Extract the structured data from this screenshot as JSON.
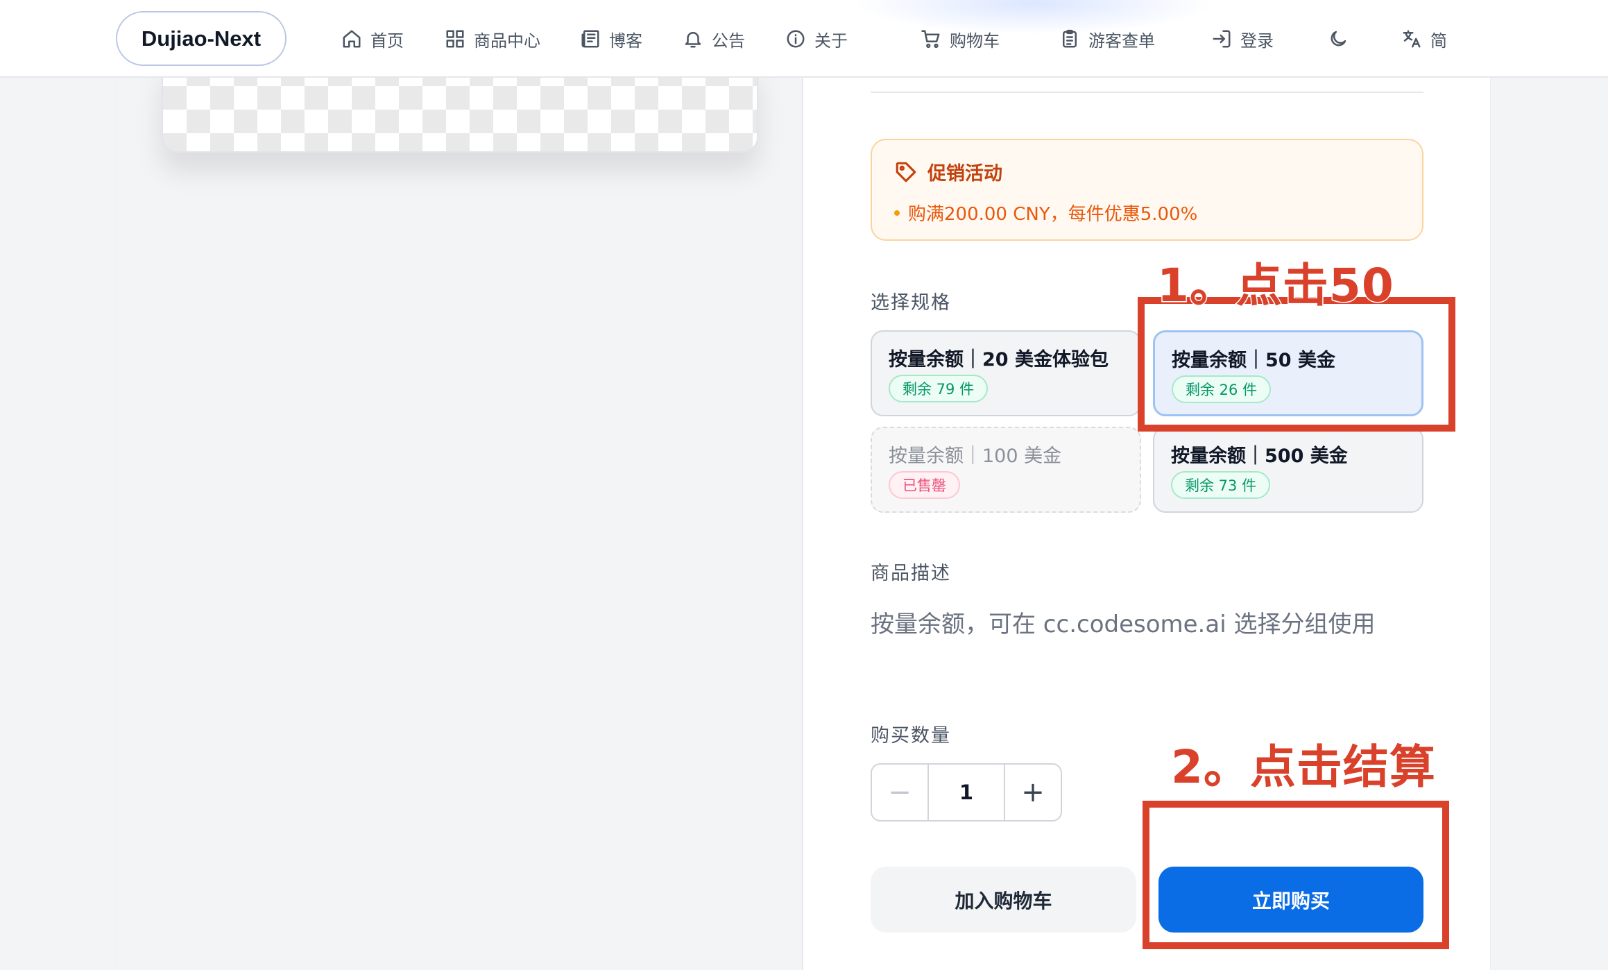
{
  "nav": {
    "brand": "Dujiao-Next",
    "items": [
      {
        "label": "首页",
        "icon": "home-icon"
      },
      {
        "label": "商品中心",
        "icon": "grid-icon"
      },
      {
        "label": "博客",
        "icon": "newspaper-icon"
      },
      {
        "label": "公告",
        "icon": "bell-icon"
      },
      {
        "label": "关于",
        "icon": "info-icon"
      },
      {
        "label": "购物车",
        "icon": "cart-icon"
      },
      {
        "label": "游客查单",
        "icon": "clipboard-icon"
      },
      {
        "label": "登录",
        "icon": "login-icon"
      },
      {
        "label": "",
        "icon": "moon-icon"
      },
      {
        "label": "简",
        "icon": "translate-icon"
      }
    ]
  },
  "promo": {
    "title": "促销活动",
    "rule": "购满200.00 CNY，每件优惠5.00%",
    "icon": "tag-icon"
  },
  "spec": {
    "label": "选择规格",
    "options": [
      {
        "name": "按量余额｜20 美金体验包",
        "stock": "剩余 79 件",
        "state": "available"
      },
      {
        "name": "按量余额｜50 美金",
        "stock": "剩余 26 件",
        "state": "selected"
      },
      {
        "name": "按量余额｜100 美金",
        "stock": "已售罄",
        "state": "soldout"
      },
      {
        "name": "按量余额｜500 美金",
        "stock": "剩余 73 件",
        "state": "available"
      }
    ]
  },
  "description": {
    "label": "商品描述",
    "text": "按量余额，可在 cc.codesome.ai 选择分组使用"
  },
  "quantity": {
    "label": "购买数量",
    "minus": "−",
    "value": "1",
    "plus": "+"
  },
  "actions": {
    "add_to_cart": "加入购物车",
    "buy_now": "立即购买"
  },
  "annotations": {
    "step1": "1。点击50",
    "step2": "2。点击结算",
    "color": "#d9412b"
  },
  "colors": {
    "primary": "#0a6de6",
    "promo_text": "#ea580c",
    "stock_green": "#059669",
    "soldout_pink": "#ec4f78"
  }
}
